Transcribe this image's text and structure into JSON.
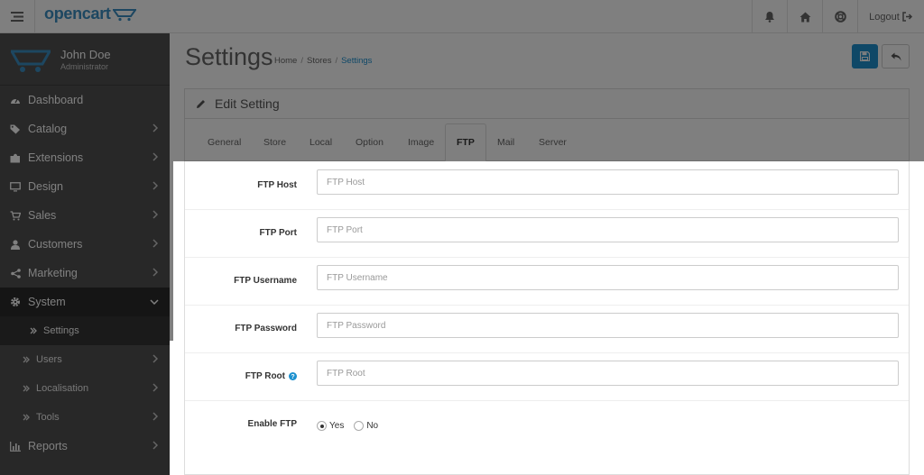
{
  "header": {
    "logo_text": "opencart",
    "logout_label": "Logout",
    "icons": [
      "menu-icon",
      "bell-icon",
      "home-icon",
      "life-ring-icon",
      "sign-out-icon"
    ]
  },
  "profile": {
    "name": "John Doe",
    "role": "Administrator"
  },
  "sidebar": {
    "items": [
      {
        "label": "Dashboard",
        "icon": "dashboard-icon",
        "chevron": false
      },
      {
        "label": "Catalog",
        "icon": "tags-icon",
        "chevron": true
      },
      {
        "label": "Extensions",
        "icon": "puzzle-icon",
        "chevron": true
      },
      {
        "label": "Design",
        "icon": "monitor-icon",
        "chevron": true
      },
      {
        "label": "Sales",
        "icon": "cart-icon",
        "chevron": true
      },
      {
        "label": "Customers",
        "icon": "user-icon",
        "chevron": true
      },
      {
        "label": "Marketing",
        "icon": "share-icon",
        "chevron": true
      },
      {
        "label": "System",
        "icon": "cog-icon",
        "chevron": true
      }
    ],
    "system_sub": [
      {
        "label": "Settings"
      },
      {
        "label": "Users"
      },
      {
        "label": "Localisation"
      },
      {
        "label": "Tools"
      }
    ],
    "reports": {
      "label": "Reports"
    }
  },
  "page": {
    "title": "Settings",
    "breadcrumb": [
      "Home",
      "Stores",
      "Settings"
    ],
    "panel_title": "Edit Setting"
  },
  "tabs": [
    "General",
    "Store",
    "Local",
    "Option",
    "Image",
    "FTP",
    "Mail",
    "Server"
  ],
  "active_tab": "FTP",
  "form": {
    "ftp_host": {
      "label": "FTP Host",
      "placeholder": "FTP Host",
      "value": ""
    },
    "ftp_port": {
      "label": "FTP Port",
      "placeholder": "FTP Port",
      "value": ""
    },
    "ftp_username": {
      "label": "FTP Username",
      "placeholder": "FTP Username",
      "value": ""
    },
    "ftp_password": {
      "label": "FTP Password",
      "placeholder": "FTP Password",
      "value": ""
    },
    "ftp_root": {
      "label": "FTP Root",
      "placeholder": "FTP Root",
      "value": ""
    },
    "enable_ftp": {
      "label": "Enable FTP",
      "options": [
        "Yes",
        "No"
      ],
      "selected": "Yes"
    }
  },
  "colors": {
    "brand": "#1e91cf",
    "sidebar": "#515151",
    "active_nav": "#2b2b2b"
  }
}
